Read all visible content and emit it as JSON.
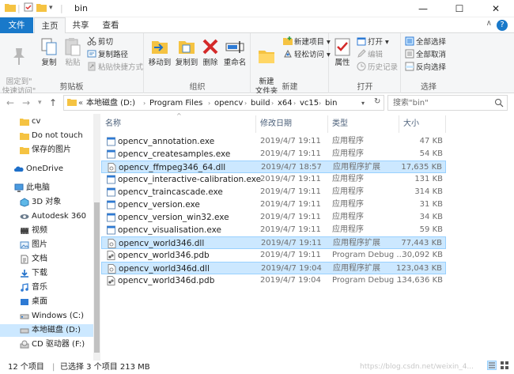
{
  "window": {
    "title": "bin",
    "controls": {
      "minimize": "—",
      "maximize": "☐",
      "close": "✕"
    }
  },
  "ribbon_tabs": [
    {
      "label": "文件"
    },
    {
      "label": "主页"
    },
    {
      "label": "共享"
    },
    {
      "label": "查看"
    }
  ],
  "ribbon": {
    "clipboard": {
      "pin_quick_access": "固定到\"\n快速访问\"",
      "copy": "复制",
      "paste": "粘贴",
      "cut": "剪切",
      "copy_path": "复制路径",
      "paste_shortcut": "粘贴快捷方式",
      "group_label": "剪贴板"
    },
    "organize": {
      "move_to": "移动到",
      "copy_to": "复制到",
      "delete": "删除",
      "rename": "重命名",
      "group_label": "组织"
    },
    "new": {
      "new_folder": "新建\n文件夹",
      "new_item": "新建项目 ▾",
      "easy_access": "轻松访问 ▾",
      "group_label": "新建"
    },
    "open": {
      "properties": "属性",
      "open": "打开 ▾",
      "edit": "编辑",
      "history": "历史记录",
      "group_label": "打开"
    },
    "select": {
      "select_all": "全部选择",
      "select_none": "全部取消",
      "invert": "反向选择",
      "group_label": "选择"
    }
  },
  "address": {
    "overflow": "«",
    "crumbs": [
      "本地磁盘 (D:)",
      "Program Files",
      "opencv",
      "build",
      "x64",
      "vc15",
      "bin"
    ],
    "search_placeholder": "搜索\"bin\""
  },
  "nav_pane": {
    "items": [
      {
        "label": "cv",
        "icon": "folder-icon"
      },
      {
        "label": "Do not touch",
        "icon": "folder-icon"
      },
      {
        "label": "保存的图片",
        "icon": "folder-icon"
      },
      {
        "label": "OneDrive",
        "icon": "cloud-icon"
      },
      {
        "label": "此电脑",
        "icon": "computer-icon"
      },
      {
        "label": "3D 对象",
        "icon": "3d-objects-icon"
      },
      {
        "label": "Autodesk 360",
        "icon": "autodesk-icon"
      },
      {
        "label": "视频",
        "icon": "video-icon"
      },
      {
        "label": "图片",
        "icon": "pictures-icon"
      },
      {
        "label": "文档",
        "icon": "documents-icon"
      },
      {
        "label": "下载",
        "icon": "downloads-icon"
      },
      {
        "label": "音乐",
        "icon": "music-icon"
      },
      {
        "label": "桌面",
        "icon": "desktop-icon"
      },
      {
        "label": "Windows (C:)",
        "icon": "drive-icon"
      },
      {
        "label": "本地磁盘 (D:)",
        "icon": "drive-icon"
      },
      {
        "label": "CD 驱动器 (F:)",
        "icon": "cd-drive-icon"
      }
    ]
  },
  "file_list": {
    "columns": {
      "name": "名称",
      "date": "修改日期",
      "type": "类型",
      "size": "大小"
    },
    "rows": [
      {
        "name": "opencv_annotation.exe",
        "date": "2019/4/7 19:11",
        "type": "应用程序",
        "size": "47 KB",
        "kind": "exe",
        "selected": false
      },
      {
        "name": "opencv_createsamples.exe",
        "date": "2019/4/7 19:11",
        "type": "应用程序",
        "size": "54 KB",
        "kind": "exe",
        "selected": false
      },
      {
        "name": "opencv_ffmpeg346_64.dll",
        "date": "2019/4/7 18:57",
        "type": "应用程序扩展",
        "size": "17,635 KB",
        "kind": "dll",
        "selected": true
      },
      {
        "name": "opencv_interactive-calibration.exe",
        "date": "2019/4/7 19:11",
        "type": "应用程序",
        "size": "131 KB",
        "kind": "exe",
        "selected": false
      },
      {
        "name": "opencv_traincascade.exe",
        "date": "2019/4/7 19:11",
        "type": "应用程序",
        "size": "314 KB",
        "kind": "exe",
        "selected": false
      },
      {
        "name": "opencv_version.exe",
        "date": "2019/4/7 19:11",
        "type": "应用程序",
        "size": "31 KB",
        "kind": "exe",
        "selected": false
      },
      {
        "name": "opencv_version_win32.exe",
        "date": "2019/4/7 19:11",
        "type": "应用程序",
        "size": "34 KB",
        "kind": "exe",
        "selected": false
      },
      {
        "name": "opencv_visualisation.exe",
        "date": "2019/4/7 19:11",
        "type": "应用程序",
        "size": "59 KB",
        "kind": "exe",
        "selected": false
      },
      {
        "name": "opencv_world346.dll",
        "date": "2019/4/7 19:11",
        "type": "应用程序扩展",
        "size": "77,443 KB",
        "kind": "dll",
        "selected": true
      },
      {
        "name": "opencv_world346.pdb",
        "date": "2019/4/7 19:11",
        "type": "Program Debug ...",
        "size": "30,092 KB",
        "kind": "pdb",
        "selected": false
      },
      {
        "name": "opencv_world346d.dll",
        "date": "2019/4/7 19:04",
        "type": "应用程序扩展",
        "size": "123,043 KB",
        "kind": "dll",
        "selected": true
      },
      {
        "name": "opencv_world346d.pdb",
        "date": "2019/4/7 19:04",
        "type": "Program Debug ...",
        "size": "134,636 KB",
        "kind": "pdb",
        "selected": false
      }
    ]
  },
  "status": {
    "item_count": "12 个项目",
    "selection": "已选择 3 个项目  213 MB",
    "watermark": "https://blog.csdn.net/weixin_4..."
  },
  "colors": {
    "accent": "#1979ca",
    "selection_bg": "#cce8ff",
    "selection_border": "#99d1ff",
    "folder": "#f5c342"
  }
}
